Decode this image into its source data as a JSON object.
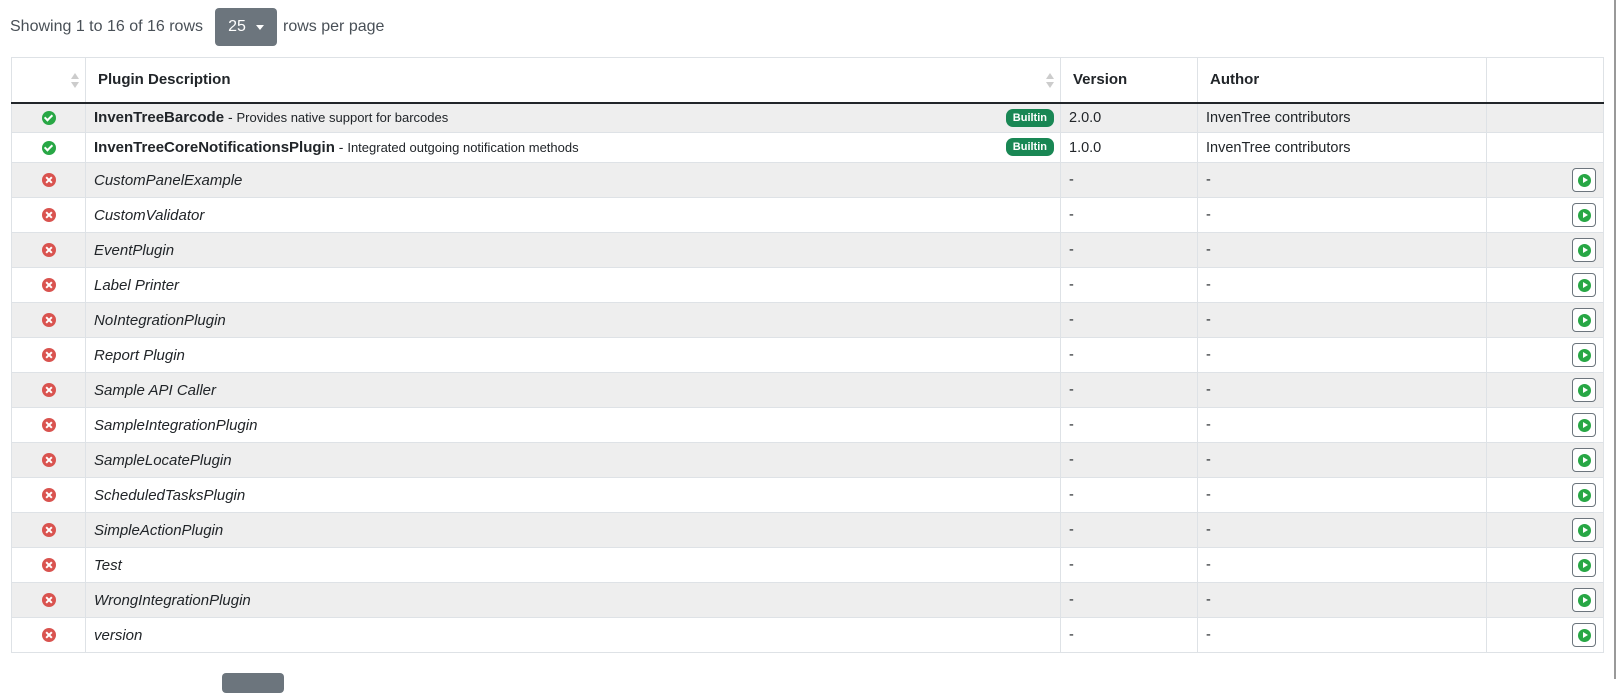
{
  "pagination": {
    "showing_text": "Showing 1 to 16 of 16 rows",
    "page_size": "25",
    "rows_per_page_text": "rows per page"
  },
  "table": {
    "columns": [
      "",
      "Plugin Description",
      "Version",
      "Author",
      ""
    ],
    "rows": [
      {
        "status": "active",
        "name": "InvenTreeBarcode",
        "description": "Provides native support for barcodes",
        "badge": "Builtin",
        "version": "2.0.0",
        "author": "InvenTree contributors"
      },
      {
        "status": "active",
        "name": "InvenTreeCoreNotificationsPlugin",
        "description": "Integrated outgoing notification methods",
        "badge": "Builtin",
        "version": "1.0.0",
        "author": "InvenTree contributors"
      },
      {
        "status": "inactive",
        "name": "CustomPanelExample",
        "version": "-",
        "author": "-"
      },
      {
        "status": "inactive",
        "name": "CustomValidator",
        "version": "-",
        "author": "-"
      },
      {
        "status": "inactive",
        "name": "EventPlugin",
        "version": "-",
        "author": "-"
      },
      {
        "status": "inactive",
        "name": "Label Printer",
        "version": "-",
        "author": "-"
      },
      {
        "status": "inactive",
        "name": "NoIntegrationPlugin",
        "version": "-",
        "author": "-"
      },
      {
        "status": "inactive",
        "name": "Report Plugin",
        "version": "-",
        "author": "-"
      },
      {
        "status": "inactive",
        "name": "Sample API Caller",
        "version": "-",
        "author": "-"
      },
      {
        "status": "inactive",
        "name": "SampleIntegrationPlugin",
        "version": "-",
        "author": "-"
      },
      {
        "status": "inactive",
        "name": "SampleLocatePlugin",
        "version": "-",
        "author": "-"
      },
      {
        "status": "inactive",
        "name": "ScheduledTasksPlugin",
        "version": "-",
        "author": "-"
      },
      {
        "status": "inactive",
        "name": "SimpleActionPlugin",
        "version": "-",
        "author": "-"
      },
      {
        "status": "inactive",
        "name": "Test",
        "version": "-",
        "author": "-"
      },
      {
        "status": "inactive",
        "name": "WrongIntegrationPlugin",
        "version": "-",
        "author": "-"
      },
      {
        "status": "inactive",
        "name": "version",
        "version": "-",
        "author": "-"
      }
    ]
  },
  "icons": {
    "active": "check-circle-icon",
    "inactive": "x-circle-icon",
    "activate": "play-circle-icon"
  },
  "colors": {
    "active": "#28a745",
    "inactive": "#d9534f",
    "badge": "#198754",
    "page_size_button": "#6c757d"
  }
}
